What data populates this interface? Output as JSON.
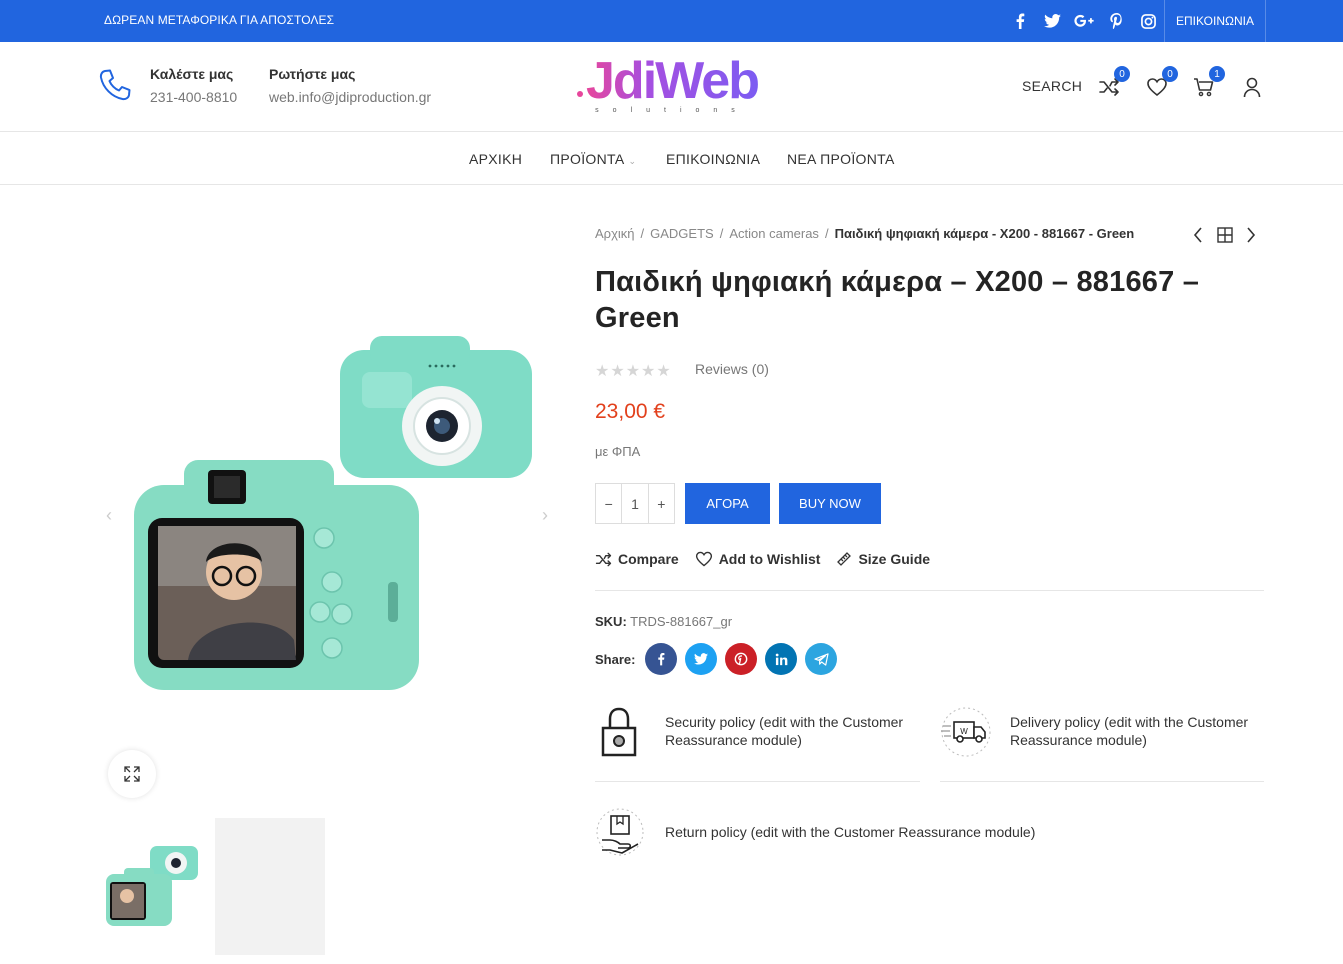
{
  "topbar": {
    "promo": "ΔΩΡΕΑΝ ΜΕΤΑΦΟΡΙΚΑ ΓΙΑ ΑΠΟΣΤΟΛΕΣ",
    "contact": "ΕΠΙΚΟΙΝΩΝΙΑ",
    "socials": [
      "facebook-icon",
      "twitter-icon",
      "google-plus-icon",
      "pinterest-icon",
      "instagram-icon"
    ]
  },
  "header": {
    "call_title": "Καλέστε μας",
    "call_value": "231-400-8810",
    "ask_title": "Ρωτήστε μας",
    "ask_value": "web.info@jdiproduction.gr",
    "logo_text": "JdiWeb",
    "logo_sub": "solutions",
    "search_label": "SEARCH",
    "compare_count": "0",
    "wishlist_count": "0",
    "cart_count": "1"
  },
  "nav": {
    "items": [
      "ΑΡΧΙΚΗ",
      "ΠΡΟΪΟΝΤΑ",
      "ΕΠΙΚΟΙΝΩΝΙΑ",
      "ΝΕΑ ΠΡΟΪΟΝΤΑ"
    ]
  },
  "breadcrumb": {
    "items": [
      "Αρχική",
      "GADGETS",
      "Action cameras"
    ],
    "separator": "/",
    "current": "Παιδική ψηφιακή κάμερα - X200 - 881667 - Green"
  },
  "product": {
    "title": "Παιδική ψηφιακή κάμερα – X200 – 881667 – Green",
    "rating": 0,
    "reviews": "Reviews (0)",
    "price": "23,00 €",
    "vat_note": "με ΦΠΑ",
    "qty": "1",
    "qty_minus": "−",
    "qty_plus": "+",
    "buy_label": "ΑΓΟΡΑ",
    "buy_now_label": "BUY NOW",
    "compare_label": "Compare",
    "wishlist_label": "Add to Wishlist",
    "size_guide_label": "Size Guide",
    "sku_label": "SKU:",
    "sku_value": "TRDS-881667_gr",
    "share_label": "Share:"
  },
  "reassurance": {
    "security": "Security policy (edit with the Customer Reassurance module)",
    "delivery": "Delivery policy (edit with the Customer Reassurance module)",
    "return": "Return policy (edit with the Customer Reassurance module)"
  },
  "colors": {
    "brand_blue": "#2165df",
    "price_red": "#e2401c",
    "camera_mint": "#7fdcc6"
  }
}
